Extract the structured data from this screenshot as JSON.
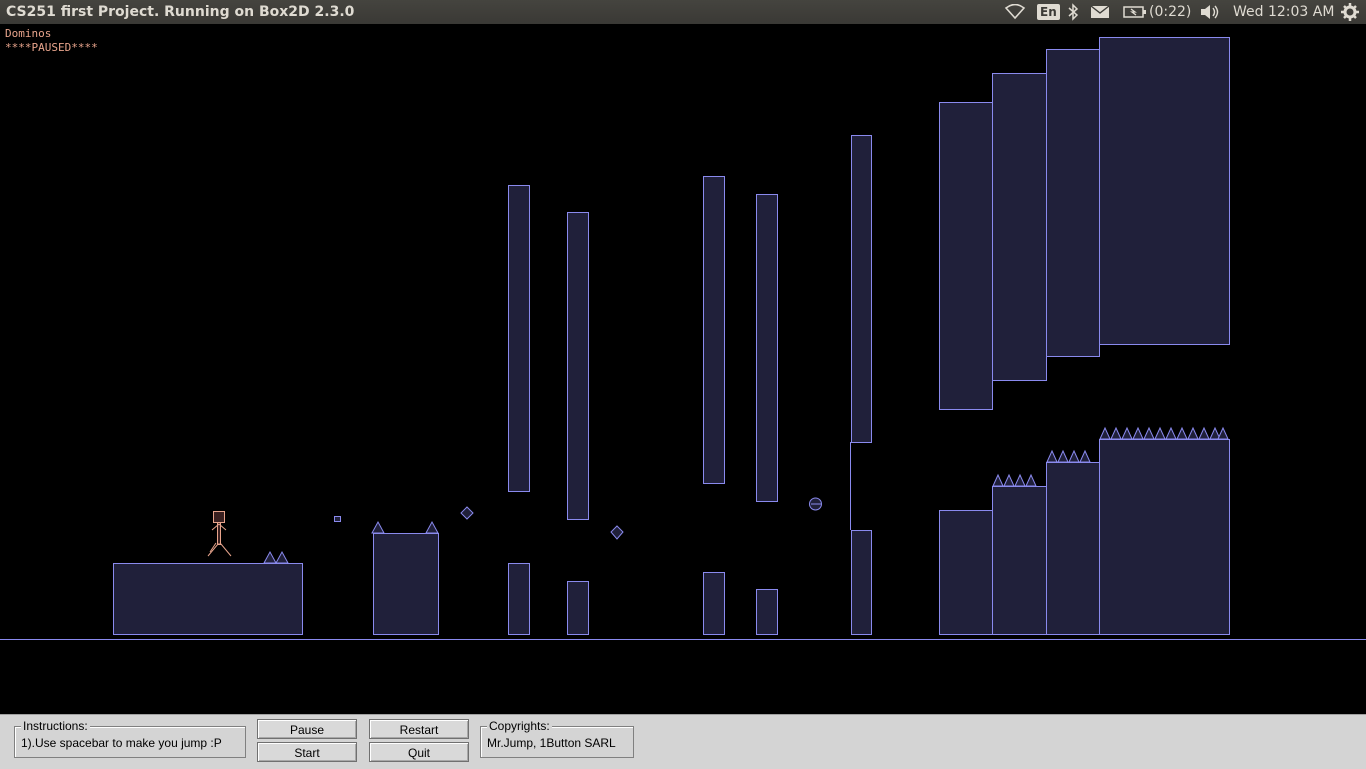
{
  "window": {
    "title": "CS251 first Project. Running on Box2D 2.3.0"
  },
  "system_tray": {
    "wifi_icon": "wifi-icon",
    "language": "En",
    "bluetooth_icon": "bluetooth-icon",
    "mail_icon": "mail-icon",
    "battery_icon": "battery-icon",
    "battery_text": "(0:22)",
    "volume_icon": "volume-icon",
    "clock": "Wed 12:03 AM",
    "settings_icon": "gear-icon"
  },
  "simulation": {
    "test_name": "Dominos",
    "status": "****PAUSED****",
    "colors": {
      "background": "#000000",
      "body_fill": "#20203a",
      "body_stroke": "#8a8aee",
      "player": "#e8a48c",
      "overlay_text": "#e8a48c"
    }
  },
  "controls": {
    "instructions_label": "Instructions:",
    "instructions_text": "1).Use spacebar to make you jump :P",
    "pause_label": "Pause",
    "start_label": "Start",
    "restart_label": "Restart",
    "quit_label": "Quit",
    "copyrights_label": "Copyrights:",
    "copyrights_text": "Mr.Jump, 1Button SARL"
  }
}
